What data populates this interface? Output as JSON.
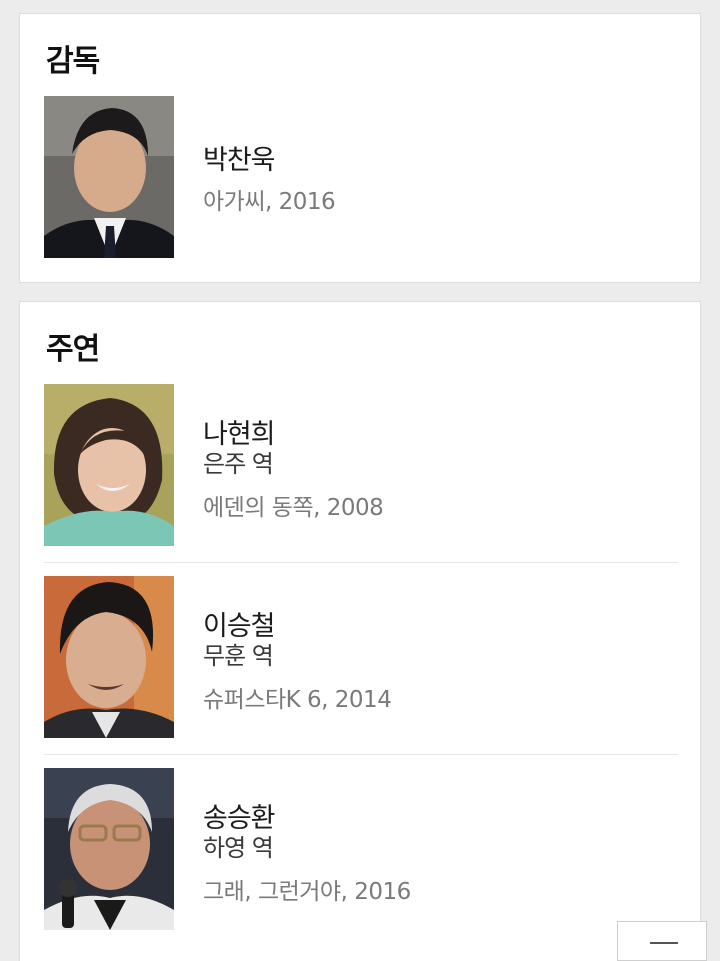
{
  "director_section": {
    "title": "감독",
    "people": [
      {
        "name": "박찬욱",
        "work": "아가씨, 2016"
      }
    ]
  },
  "cast_section": {
    "title": "주연",
    "people": [
      {
        "name": "나현희",
        "role": "은주 역",
        "work": "에덴의 동쪽, 2008"
      },
      {
        "name": "이승철",
        "role": "무훈 역",
        "work": "슈퍼스타K 6, 2014"
      },
      {
        "name": "송승환",
        "role": "하영 역",
        "work": "그래, 그런거야, 2016"
      }
    ]
  },
  "icons": {
    "scroll_top_button": "menu-lines-icon"
  }
}
